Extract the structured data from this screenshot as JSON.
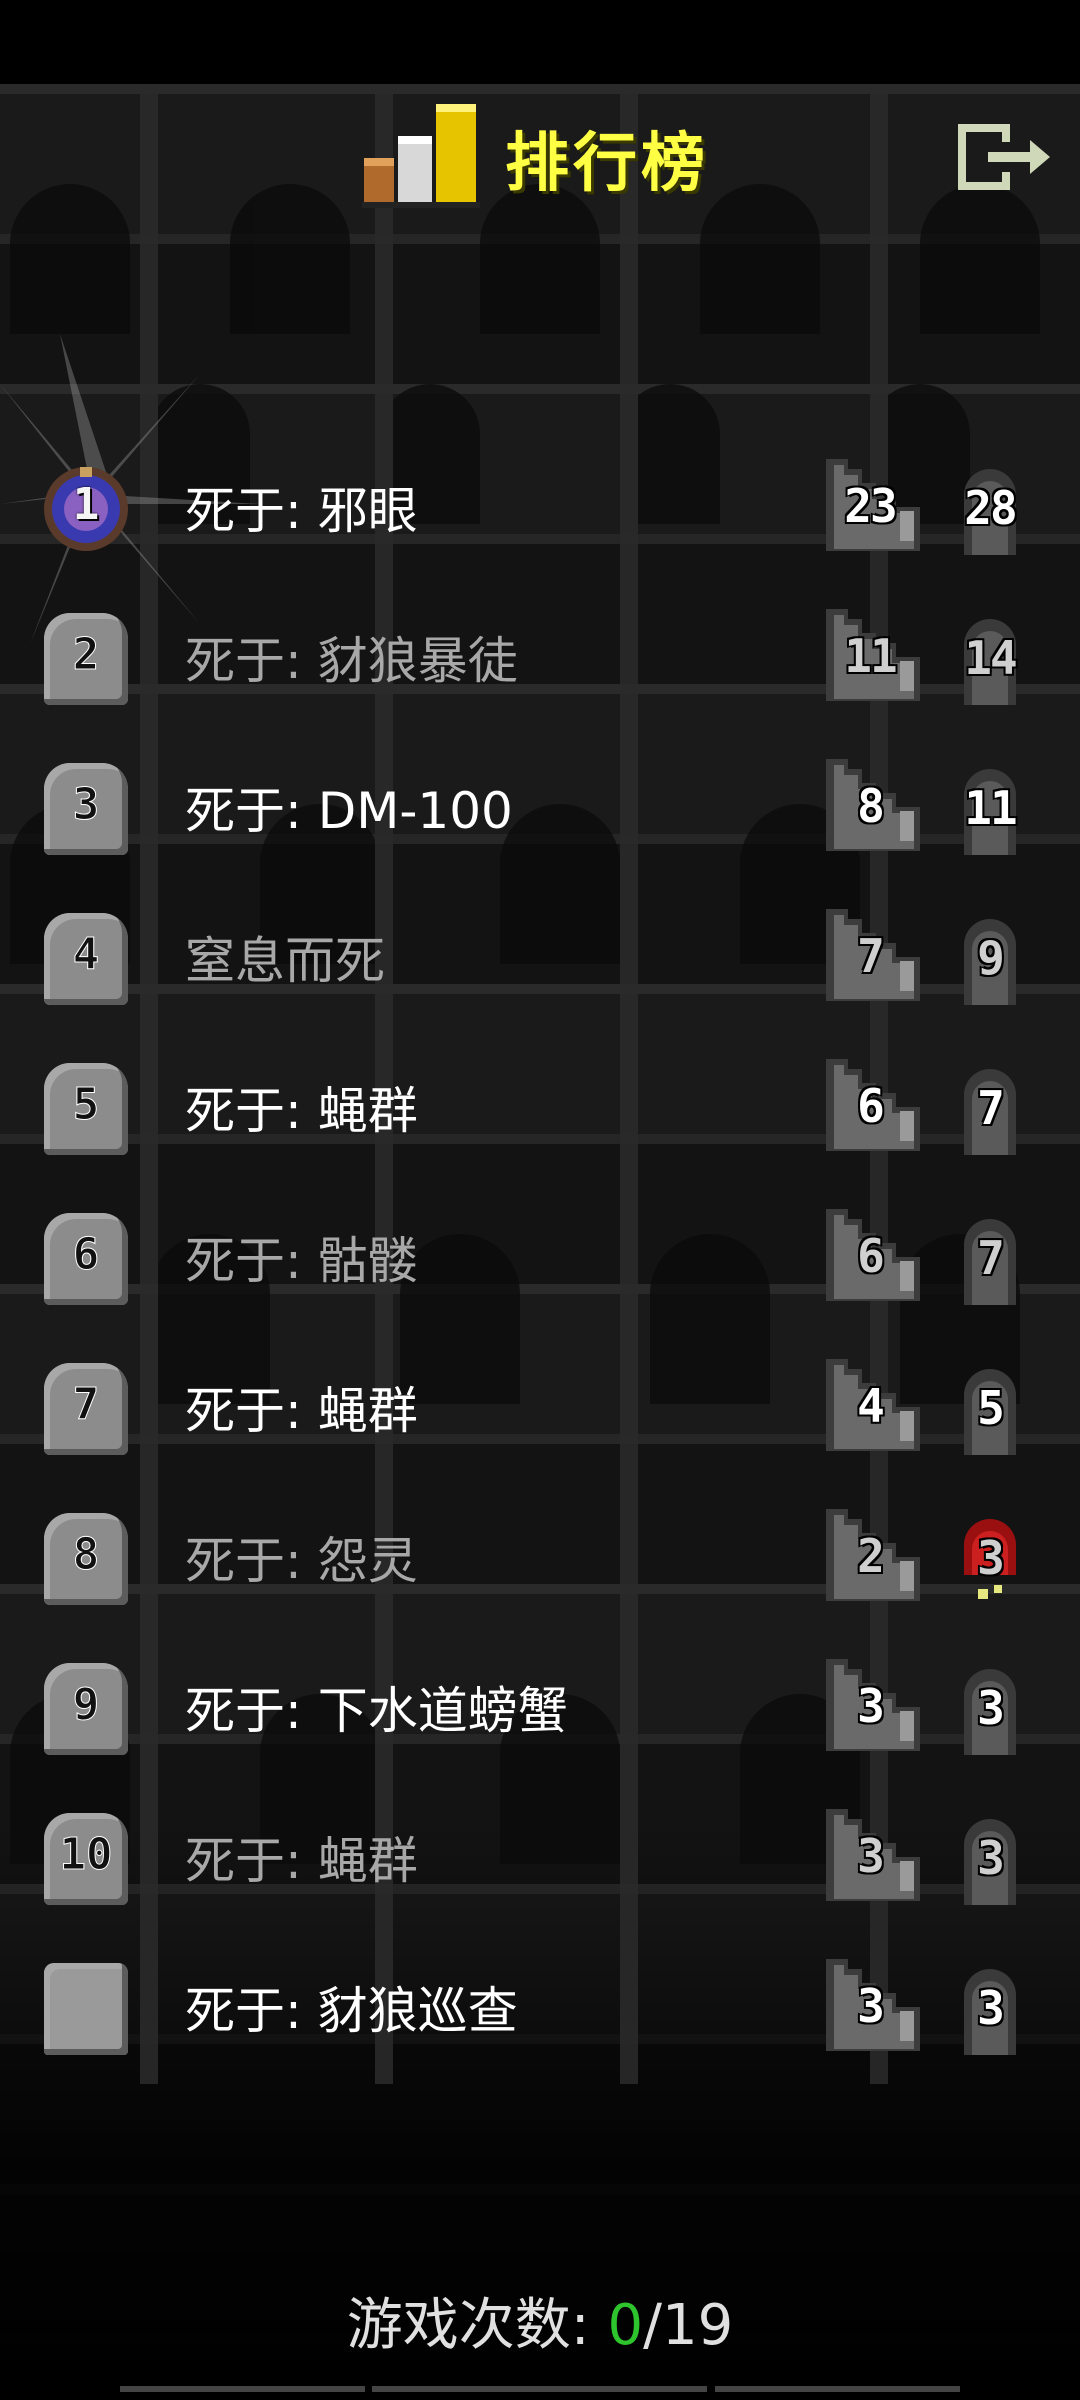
{
  "header": {
    "title": "排行榜",
    "trophy_icon": "bar-chart-trophy-icon",
    "exit_icon": "exit-icon"
  },
  "colors": {
    "title": "#ffff44",
    "highlight": "#ffffff",
    "dim_text": "#a8a8a8",
    "current_games": "#2ec42e"
  },
  "entries": [
    {
      "rank": "1",
      "cause": "死于: 邪眼",
      "score": "23",
      "depth": "28",
      "dim": false
    },
    {
      "rank": "2",
      "cause": "死于: 豺狼暴徒",
      "score": "11",
      "depth": "14",
      "dim": true
    },
    {
      "rank": "3",
      "cause": "死于: DM-100",
      "score": "8",
      "depth": "11",
      "dim": false
    },
    {
      "rank": "4",
      "cause": "窒息而死",
      "score": "7",
      "depth": "9",
      "dim": true
    },
    {
      "rank": "5",
      "cause": "死于: 蝇群",
      "score": "6",
      "depth": "7",
      "dim": false
    },
    {
      "rank": "6",
      "cause": "死于: 骷髅",
      "score": "6",
      "depth": "7",
      "dim": true
    },
    {
      "rank": "7",
      "cause": "死于: 蝇群",
      "score": "4",
      "depth": "5",
      "dim": false
    },
    {
      "rank": "8",
      "cause": "死于: 怨灵",
      "score": "2",
      "depth": "3",
      "dim": true
    },
    {
      "rank": "9",
      "cause": "死于: 下水道螃蟹",
      "score": "3",
      "depth": "3",
      "dim": false
    },
    {
      "rank": "10",
      "cause": "死于: 蝇群",
      "score": "3",
      "depth": "3",
      "dim": true
    },
    {
      "rank": "",
      "cause": "死于: 豺狼巡查",
      "score": "3",
      "depth": "3",
      "dim": false
    }
  ],
  "footer": {
    "label": "游戏次数: ",
    "current": "0",
    "total": "/19"
  }
}
